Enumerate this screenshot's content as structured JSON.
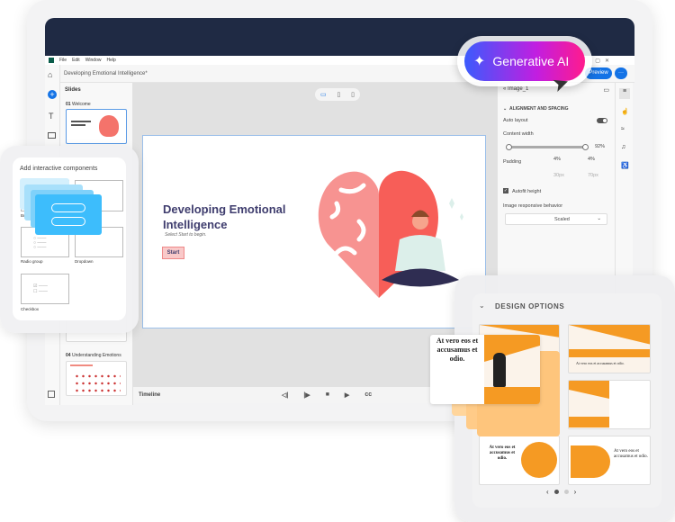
{
  "menu": {
    "items": [
      "File",
      "Edit",
      "Window",
      "Help"
    ]
  },
  "document": {
    "title": "Developing Emotional Intelligence*"
  },
  "slides_panel": {
    "title": "Slides",
    "items": [
      {
        "number": "01",
        "label": "Welcome"
      },
      {
        "number": "04",
        "label": "Understanding Emotions"
      }
    ]
  },
  "generative_ai": {
    "label": "Generative AI",
    "gradient": [
      "#3b5bfd",
      "#c21ee0",
      "#ff1b8d"
    ]
  },
  "toolbar": {
    "preview_label": "Preview",
    "more_label": "···"
  },
  "slide": {
    "title": "Developing Emotional Intelligence",
    "subtitle": "Select Start to begin.",
    "start_label": "Start",
    "title_color": "#3f3d6e"
  },
  "timeline": {
    "label": "Timeline"
  },
  "properties": {
    "object_name": "Image_1",
    "section": "ALIGNMENT AND SPACING",
    "auto_layout_label": "Auto layout",
    "auto_layout_on": true,
    "content_width_label": "Content width",
    "content_width_value": "92%",
    "padding_label": "Padding",
    "padding_left": "4%",
    "padding_right": "4%",
    "padding_top": "30px",
    "padding_bottom": "70px",
    "autofit_label": "Autofit height",
    "autofit_checked": true,
    "responsive_label": "Image responsive behavior",
    "responsive_value": "Scaled"
  },
  "components_card": {
    "title": "Add interactive components",
    "items": [
      "Button",
      "Radio group",
      "Dropdown",
      "Checkbox"
    ]
  },
  "design_options": {
    "title": "DESIGN OPTIONS",
    "sample_text": "At vero eos et accusamus et odio.",
    "page": 1,
    "pages": 2,
    "accent": "#f59a23"
  }
}
